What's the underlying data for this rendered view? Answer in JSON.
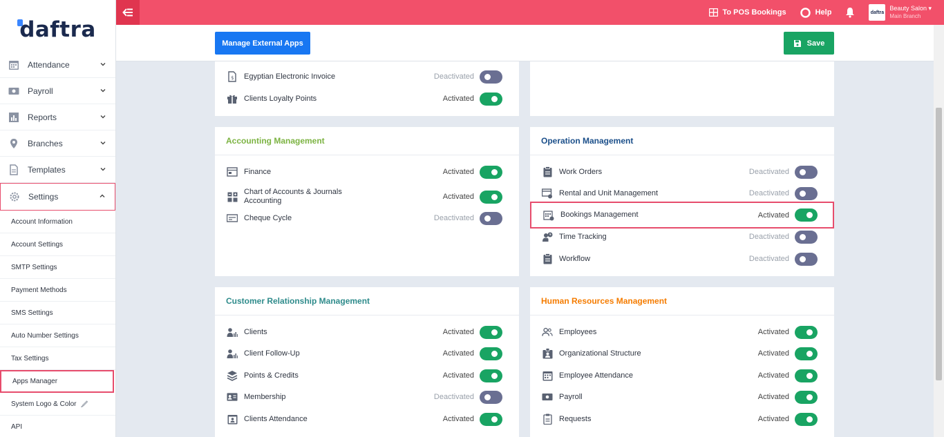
{
  "brand": {
    "logo_text": "daftra"
  },
  "sidebar": {
    "items": [
      {
        "label": "Attendance"
      },
      {
        "label": "Payroll"
      },
      {
        "label": "Reports"
      },
      {
        "label": "Branches"
      },
      {
        "label": "Templates"
      },
      {
        "label": "Settings"
      }
    ],
    "sub_items": [
      {
        "label": "Account Information"
      },
      {
        "label": "Account Settings"
      },
      {
        "label": "SMTP Settings"
      },
      {
        "label": "Payment Methods"
      },
      {
        "label": "SMS Settings"
      },
      {
        "label": "Auto Number Settings"
      },
      {
        "label": "Tax Settings"
      },
      {
        "label": "Apps Manager"
      },
      {
        "label": "System Logo & Color"
      },
      {
        "label": "API"
      }
    ]
  },
  "topbar": {
    "pos_label": "To POS Bookings",
    "help_label": "Help",
    "user_name": "Beauty Salon",
    "user_branch": "Main Branch",
    "avatar_text": "daftra"
  },
  "actions": {
    "manage_label": "Manage External Apps",
    "save_label": "Save"
  },
  "panels": {
    "top_left": {
      "rows": [
        {
          "label": "Egyptian Electronic Invoice",
          "status": "Deactivated",
          "on": false
        },
        {
          "label": "Clients Loyalty Points",
          "status": "Activated",
          "on": true
        }
      ]
    },
    "accounting": {
      "title": "Accounting Management",
      "color": "#7cb342",
      "rows": [
        {
          "label": "Finance",
          "status": "Activated",
          "on": true
        },
        {
          "label": "Chart of Accounts & Journals",
          "label2": "Accounting",
          "status": "Activated",
          "on": true
        },
        {
          "label": "Cheque Cycle",
          "status": "Deactivated",
          "on": false
        }
      ]
    },
    "operation": {
      "title": "Operation Management",
      "color": "#1b4f8a",
      "rows": [
        {
          "label": "Work Orders",
          "status": "Deactivated",
          "on": false
        },
        {
          "label": "Rental and Unit Management",
          "status": "Deactivated",
          "on": false
        },
        {
          "label": "Bookings Management",
          "status": "Activated",
          "on": true
        },
        {
          "label": "Time Tracking",
          "status": "Deactivated",
          "on": false
        },
        {
          "label": "Workflow",
          "status": "Deactivated",
          "on": false
        }
      ]
    },
    "crm": {
      "title": "Customer Relationship Management",
      "color": "#2e8b8b",
      "rows": [
        {
          "label": "Clients",
          "status": "Activated",
          "on": true
        },
        {
          "label": "Client Follow-Up",
          "status": "Activated",
          "on": true
        },
        {
          "label": "Points & Credits",
          "status": "Activated",
          "on": true
        },
        {
          "label": "Membership",
          "status": "Deactivated",
          "on": false
        },
        {
          "label": "Clients Attendance",
          "status": "Activated",
          "on": true
        }
      ]
    },
    "hr": {
      "title": "Human Resources Management",
      "color": "#f57c00",
      "rows": [
        {
          "label": "Employees",
          "status": "Activated",
          "on": true
        },
        {
          "label": "Organizational Structure",
          "status": "Activated",
          "on": true
        },
        {
          "label": "Employee Attendance",
          "status": "Activated",
          "on": true
        },
        {
          "label": "Payroll",
          "status": "Activated",
          "on": true
        },
        {
          "label": "Requests",
          "status": "Activated",
          "on": true
        }
      ]
    }
  }
}
